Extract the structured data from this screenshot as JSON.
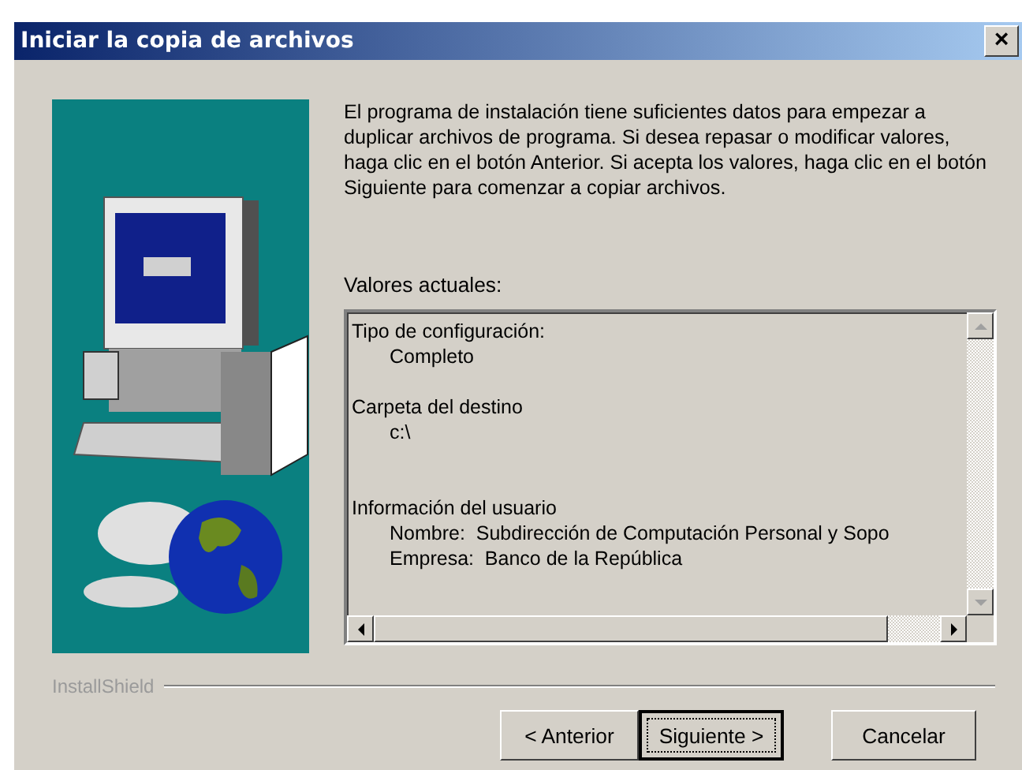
{
  "window": {
    "title": "Iniciar la copia de archivos",
    "close": "×"
  },
  "intro": "El programa de instalación tiene suficientes datos para empezar a duplicar archivos de programa. Si desea repasar o modificar valores, haga clic en el botón Anterior. Si acepta los valores, haga clic en el botón Siguiente para comenzar a copiar archivos.",
  "values_label": "Valores actuales:",
  "values_groups": [
    {
      "heading": "Tipo de configuración:",
      "items": [
        "Completo"
      ]
    },
    {
      "heading": "Carpeta del destino",
      "items": [
        "c:\\"
      ]
    },
    {
      "heading": "Información del usuario",
      "items": [
        "Nombre:  Subdirección de Computación Personal y Sopo",
        "Empresa:  Banco de la República"
      ]
    }
  ],
  "brand": "InstallShield",
  "buttons": [
    {
      "label": "< Anterior",
      "default": false
    },
    {
      "label": "Siguiente >",
      "default": true
    },
    {
      "label": "Cancelar",
      "default": false
    }
  ]
}
